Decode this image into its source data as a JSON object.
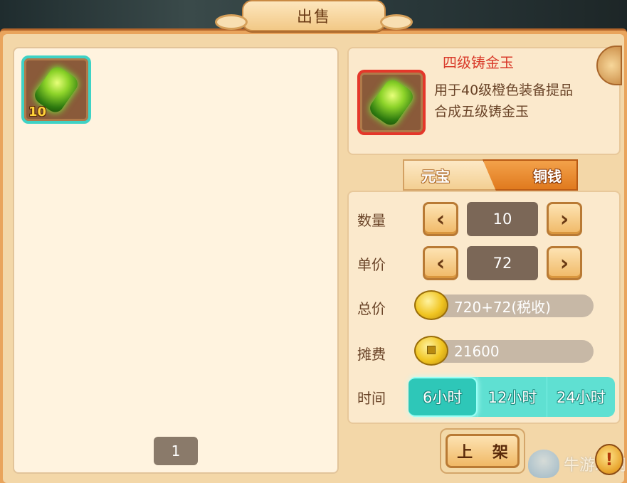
{
  "title": "出售",
  "inventory": {
    "slot_count": "10",
    "page": "1"
  },
  "item": {
    "name": "四级铸金玉",
    "desc_line1": "用于40级橙色装备提品",
    "desc_line2": "合成五级铸金玉"
  },
  "currency_tabs": {
    "yuanbao": "元宝",
    "tongqian": "铜钱"
  },
  "form": {
    "quantity_label": "数量",
    "quantity_value": "10",
    "price_label": "单价",
    "price_value": "72",
    "total_label": "总价",
    "total_value": "720+72(税收)",
    "fee_label": "摊费",
    "fee_value": "21600",
    "time_label": "时间",
    "time_options": [
      "6小时",
      "12小时",
      "24小时"
    ],
    "selected_time": "6小时"
  },
  "actions": {
    "list_button": "上 架",
    "hint": "!"
  },
  "watermark": "牛游戏网",
  "colors": {
    "accent_teal": "#3fd2c5",
    "item_name_red": "#d93a2a",
    "panel_bg": "#fbe9cc",
    "frame_orange": "#e9a45c"
  }
}
